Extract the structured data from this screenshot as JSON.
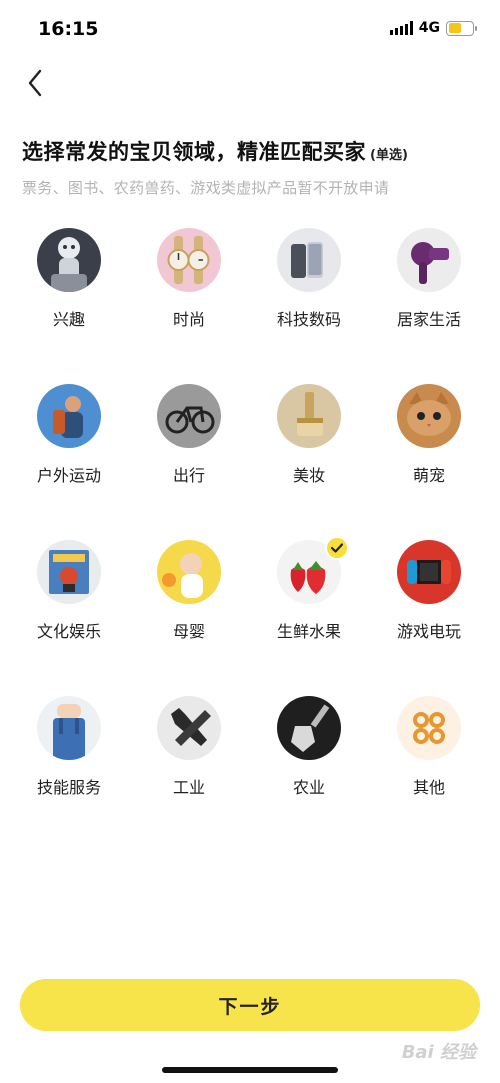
{
  "status": {
    "time": "16:15",
    "network": "4G"
  },
  "header": {
    "back_icon": "chevron-left-icon",
    "title": "选择常发的宝贝领域，精准匹配买家",
    "title_note": "(单选)",
    "subtitle": "票务、图书、农药兽药、游戏类虚拟产品暂不开放申请"
  },
  "categories": [
    {
      "label": "兴趣",
      "icon": "figure-toy-icon"
    },
    {
      "label": "时尚",
      "icon": "watch-icon"
    },
    {
      "label": "科技数码",
      "icon": "smartphone-icon"
    },
    {
      "label": "居家生活",
      "icon": "hair-dryer-icon"
    },
    {
      "label": "户外运动",
      "icon": "hiker-icon"
    },
    {
      "label": "出行",
      "icon": "bicycle-icon"
    },
    {
      "label": "美妆",
      "icon": "cosmetics-icon"
    },
    {
      "label": "萌宠",
      "icon": "cat-icon"
    },
    {
      "label": "文化娱乐",
      "icon": "book-icon"
    },
    {
      "label": "母婴",
      "icon": "baby-icon"
    },
    {
      "label": "生鲜水果",
      "icon": "strawberry-icon",
      "selected": true
    },
    {
      "label": "游戏电玩",
      "icon": "game-console-icon"
    },
    {
      "label": "技能服务",
      "icon": "worker-overalls-icon"
    },
    {
      "label": "工业",
      "icon": "wrench-icon"
    },
    {
      "label": "农业",
      "icon": "shovel-icon"
    },
    {
      "label": "其他",
      "icon": "more-grid-icon"
    }
  ],
  "footer": {
    "next_label": "下一步"
  },
  "watermark": "Bai 经验",
  "colors": {
    "accent": "#f7e34a",
    "subtitle": "#b3b3b3",
    "other_icon": "#e8962e"
  }
}
